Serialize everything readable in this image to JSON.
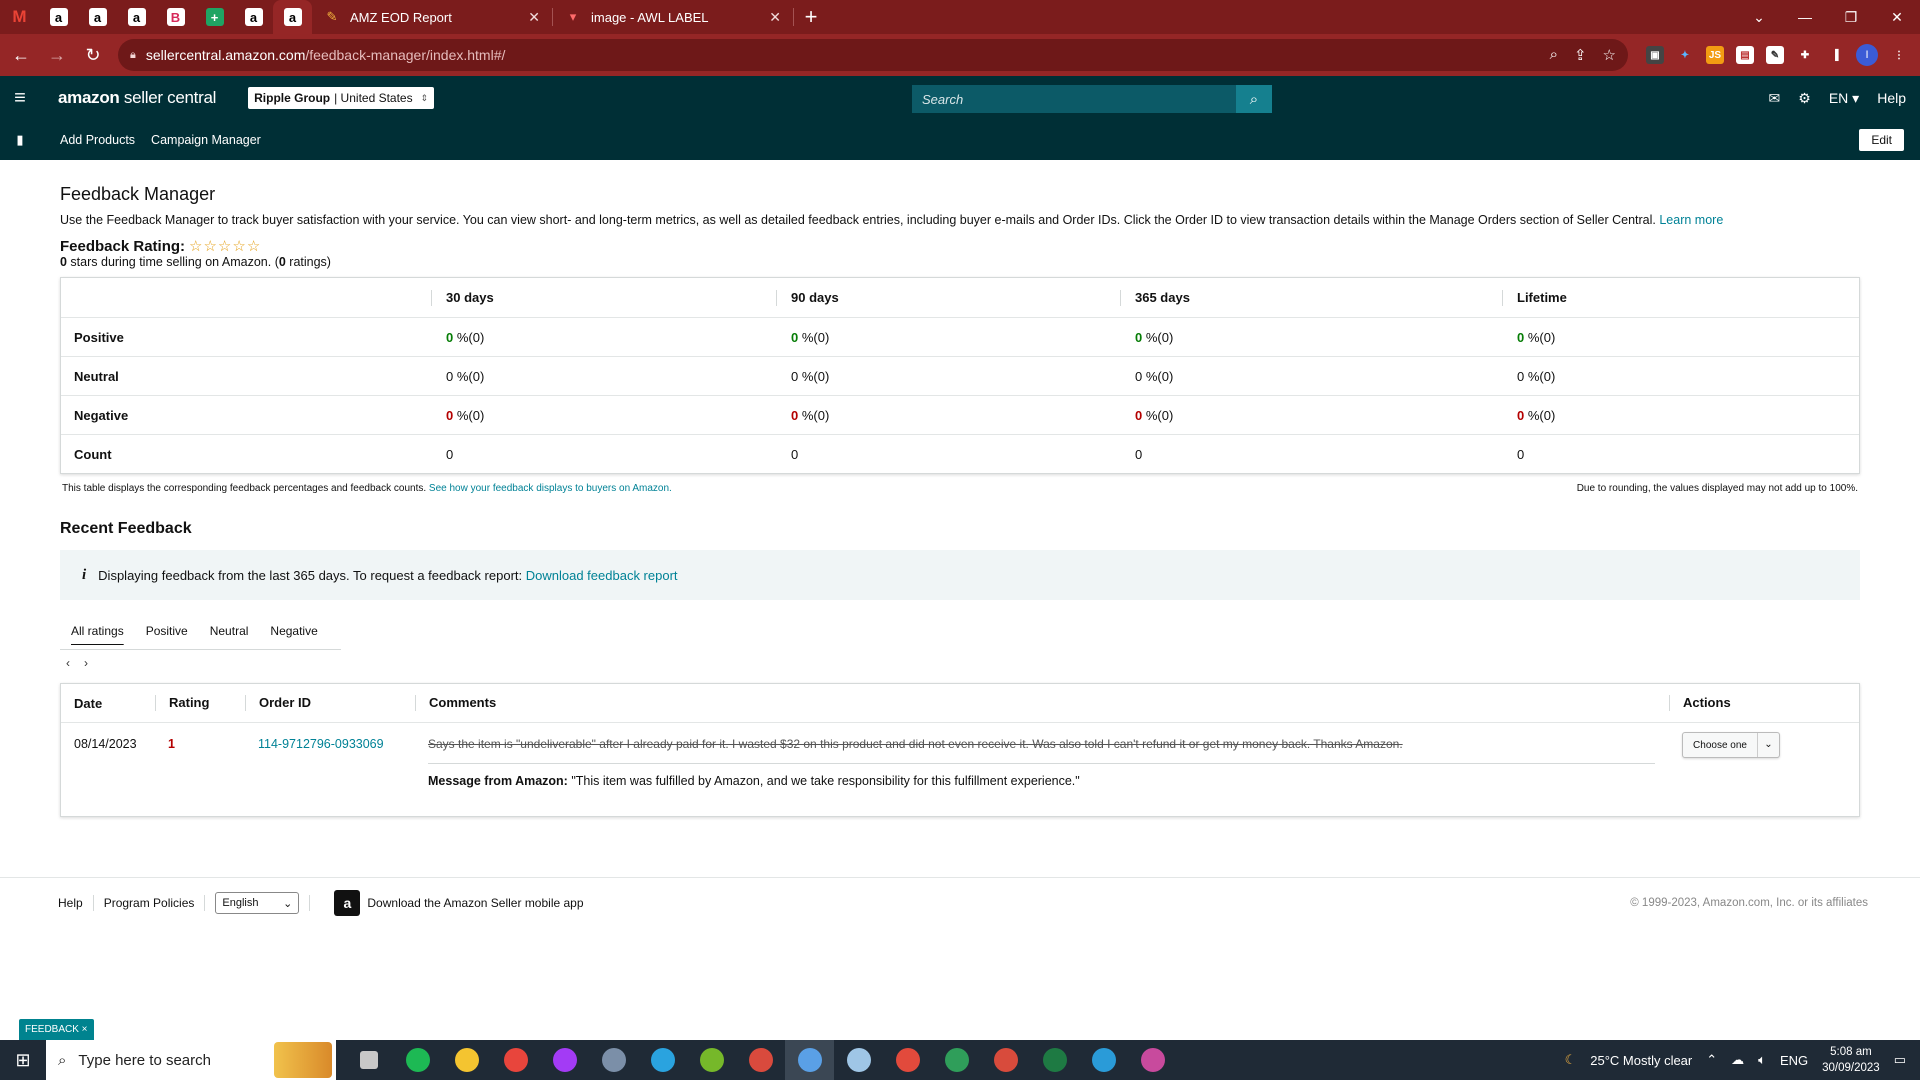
{
  "browser": {
    "pinned_tabs": [
      {
        "icon": "gmail-icon",
        "glyph": "M",
        "style": "m"
      },
      {
        "icon": "amazon-icon",
        "glyph": "a",
        "style": "a"
      },
      {
        "icon": "amazon-icon",
        "glyph": "a",
        "style": "a"
      },
      {
        "icon": "amazon-icon",
        "glyph": "a",
        "style": "a"
      },
      {
        "icon": "b-icon",
        "glyph": "B",
        "style": "b"
      },
      {
        "icon": "sheets-icon",
        "glyph": "+",
        "style": "t"
      },
      {
        "icon": "amazon-icon",
        "glyph": "a",
        "style": "a"
      },
      {
        "icon": "amazon-icon",
        "glyph": "a",
        "style": "a"
      }
    ],
    "tabs": [
      {
        "title": "AMZ EOD Report"
      },
      {
        "title": "image - AWL LABEL"
      }
    ],
    "url_host": "sellercentral.amazon.com",
    "url_path": "/feedback-manager/index.html#/"
  },
  "header": {
    "logo_main": "amazon",
    "logo_sub": " seller central",
    "store_name": "Ripple Group",
    "store_region": "| United States",
    "search_placeholder": "Search",
    "language": "EN",
    "help": "Help"
  },
  "subnav": {
    "links": [
      "Add Products",
      "Campaign Manager"
    ],
    "edit": "Edit"
  },
  "page": {
    "title": "Feedback Manager",
    "intro": "Use the Feedback Manager to track buyer satisfaction with your service. You can view short- and long-term metrics, as well as detailed feedback entries, including buyer e-mails and Order IDs. Click the Order ID to view transaction details within the Manage Orders section of Seller Central.",
    "learn_more": "Learn more",
    "rating_label": "Feedback Rating:",
    "stars": "☆☆☆☆☆",
    "rating_stars_value": "0",
    "rating_mid": " stars during time selling on Amazon. (",
    "rating_count": "0",
    "rating_end": " ratings)"
  },
  "feedback_table": {
    "headers": [
      "30 days",
      "90 days",
      "365 days",
      "Lifetime"
    ],
    "rows": [
      {
        "label": "Positive",
        "kind": "pos",
        "values": [
          "0",
          "0",
          "0",
          "0"
        ],
        "suffix": " %(0)"
      },
      {
        "label": "Neutral",
        "kind": "neu",
        "values": [
          "0",
          "0",
          "0",
          "0"
        ],
        "suffix": " %(0)"
      },
      {
        "label": "Negative",
        "kind": "neg",
        "values": [
          "0",
          "0",
          "0",
          "0"
        ],
        "suffix": " %(0)"
      },
      {
        "label": "Count",
        "kind": "plain",
        "values": [
          "0",
          "0",
          "0",
          "0"
        ],
        "suffix": ""
      }
    ],
    "note_left": "This table displays the corresponding feedback percentages and feedback counts.",
    "note_link": "See how your feedback displays to buyers on Amazon.",
    "note_right": "Due to rounding, the values displayed may not add up to 100%."
  },
  "recent": {
    "title": "Recent Feedback",
    "info_text": "Displaying feedback from the last 365 days. To request a feedback report:",
    "info_link": "Download feedback report",
    "tabs": [
      "All ratings",
      "Positive",
      "Neutral",
      "Negative"
    ],
    "columns": [
      "Date",
      "Rating",
      "Order ID",
      "Comments",
      "Actions"
    ],
    "entry": {
      "date": "08/14/2023",
      "rating": "1",
      "order_id": "114-9712796-0933069",
      "comment": "Says the item is \"undeliverable\" after I already paid for it. I wasted $32 on this product and did not even receive it. Was also told I can't refund it or get my money back. Thanks Amazon.",
      "message_label": "Message from Amazon:",
      "message_text": " \"This item was fulfilled by Amazon, and we take responsibility for this fulfillment experience.\"",
      "action": "Choose one"
    }
  },
  "footer": {
    "help": "Help",
    "policies": "Program Policies",
    "language": "English",
    "app_text": "Download the Amazon Seller mobile app",
    "copyright": "© 1999-2023, Amazon.com, Inc. or its affiliates"
  },
  "feedback_tag": "FEEDBACK ×",
  "taskbar": {
    "search_placeholder": "Type here to search",
    "weather": "25°C  Mostly clear",
    "lang": "ENG",
    "time": "5:08 am",
    "date": "30/09/2023",
    "apps": [
      {
        "icon": "task-view-icon",
        "color": "#c8c8c8"
      },
      {
        "icon": "spotify-icon",
        "color": "#1db954"
      },
      {
        "icon": "file-explorer-icon",
        "color": "#f4c430"
      },
      {
        "icon": "chrome-icon",
        "color": "#e8453c"
      },
      {
        "icon": "messenger-icon",
        "color": "#a33bf5"
      },
      {
        "icon": "calculator-icon",
        "color": "#7b8fa8"
      },
      {
        "icon": "telegram-icon",
        "color": "#2aa3df"
      },
      {
        "icon": "utorrent-icon",
        "color": "#76b82a"
      },
      {
        "icon": "chrome-profile-icon",
        "color": "#d94a3d"
      },
      {
        "icon": "chrome-profile-icon",
        "color": "#5aa0e6"
      },
      {
        "icon": "notepad-icon",
        "color": "#9fc6e6"
      },
      {
        "icon": "anydesk-icon",
        "color": "#e24a3c"
      },
      {
        "icon": "chrome-profile-icon",
        "color": "#2f9e5a"
      },
      {
        "icon": "chrome-profile-icon",
        "color": "#d84b3c"
      },
      {
        "icon": "excel-icon",
        "color": "#1e7a43"
      },
      {
        "icon": "edge-icon",
        "color": "#2a9bd8"
      },
      {
        "icon": "chrome-profile-icon",
        "color": "#c84a9d"
      }
    ]
  },
  "colors": {
    "browser_frame": "#7b1c1c",
    "seller_header": "#002f36",
    "link": "#008296",
    "positive": "#067d06",
    "negative": "#b40000"
  }
}
